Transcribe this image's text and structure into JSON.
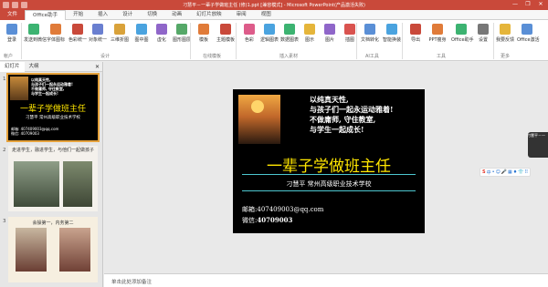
{
  "window": {
    "title": "刁慧平－一辈子学做班主任 (修)1.ppt [兼容模式] - Microsoft PowerPoint(产品激活失败)",
    "minimize": "—",
    "restore": "❐",
    "close": "✕"
  },
  "tabs": [
    "文件",
    "Office助手",
    "开始",
    "插入",
    "设计",
    "切换",
    "动画",
    "幻灯片放映",
    "审阅",
    "视图"
  ],
  "ribbon": {
    "buttons": [
      {
        "label": "登录",
        "color": "#5a8fd6"
      },
      {
        "label": "发送到微信",
        "color": "#3cb371"
      },
      {
        "label": "字体图标",
        "color": "#e07b39"
      },
      {
        "label": "色彩统一",
        "color": "#c9493a"
      },
      {
        "label": "对象统一",
        "color": "#6a7fd0"
      },
      {
        "label": "三维折图",
        "color": "#d9a23a"
      },
      {
        "label": "图中图",
        "color": "#4aa3df"
      },
      {
        "label": "虚化",
        "color": "#8f66c9"
      },
      {
        "label": "图形图层",
        "color": "#55a868"
      },
      {
        "label": "模板",
        "color": "#e07b39"
      },
      {
        "label": "主题模板",
        "color": "#c9493a"
      },
      {
        "label": "色彩",
        "color": "#dd5c8a"
      },
      {
        "label": "逻辑图表",
        "color": "#4aa3df"
      },
      {
        "label": "数据图表",
        "color": "#3cb371"
      },
      {
        "label": "图示",
        "color": "#e5b53a"
      },
      {
        "label": "图片",
        "color": "#8f66c9"
      },
      {
        "label": "插图",
        "color": "#d9534f"
      },
      {
        "label": "文档转化",
        "color": "#5a8fd6"
      },
      {
        "label": "智能换装",
        "color": "#4aa3df"
      },
      {
        "label": "导出",
        "color": "#c9493a"
      },
      {
        "label": "PPT瘦身",
        "color": "#e07b39"
      },
      {
        "label": "Office助手",
        "color": "#3cb371"
      },
      {
        "label": "设置",
        "color": "#777777"
      },
      {
        "label": "我要反馈",
        "color": "#e5b53a"
      },
      {
        "label": "Office激活",
        "color": "#5a8fd6"
      }
    ],
    "groups": [
      "帐户",
      "设计",
      "在线模板",
      "插入素材",
      "AI工具",
      "工具",
      "更多"
    ]
  },
  "left_pane": {
    "tabs": [
      "幻灯片",
      "大纲"
    ],
    "close": "✕",
    "slides": [
      {
        "number": "1",
        "lines": [
          "以纯真天性,",
          "与孩子们一起永运动雅着!",
          "不做庸师, 守住教室,",
          "与学生一起成长!"
        ],
        "title": "一辈子学做班主任",
        "subtitle": "刁慧平   常州高级职业技术学校",
        "contact": [
          "邮箱: 407409003@qq.com",
          "微信: 40709003"
        ]
      },
      {
        "number": "2",
        "title": "走进学生，融进学生，与他们一起做孩子"
      },
      {
        "number": "3",
        "title": "会操第一，内务第二"
      }
    ]
  },
  "slide": {
    "poem": [
      "以纯真天性,",
      "与孩子们一起永运动雅着!",
      "不做庸师, 守住教室,",
      "与学生一起成长!"
    ],
    "title": "一辈子学做班主任",
    "subtitle": "刁慧平   常州高级职业技术学校",
    "email_label": "邮箱:",
    "email": "407409003@qq.com",
    "wechat_label": "微信:",
    "wechat": "40709003"
  },
  "float_panel": {
    "text": "刁慧平－一辈子..."
  },
  "ime": {
    "logo": "S",
    "lang": "中",
    "items": [
      "•",
      "☺",
      "🎤",
      "▦",
      "♦",
      "👕",
      "⠿"
    ]
  },
  "notes": {
    "placeholder": "单击此处添加备注"
  }
}
